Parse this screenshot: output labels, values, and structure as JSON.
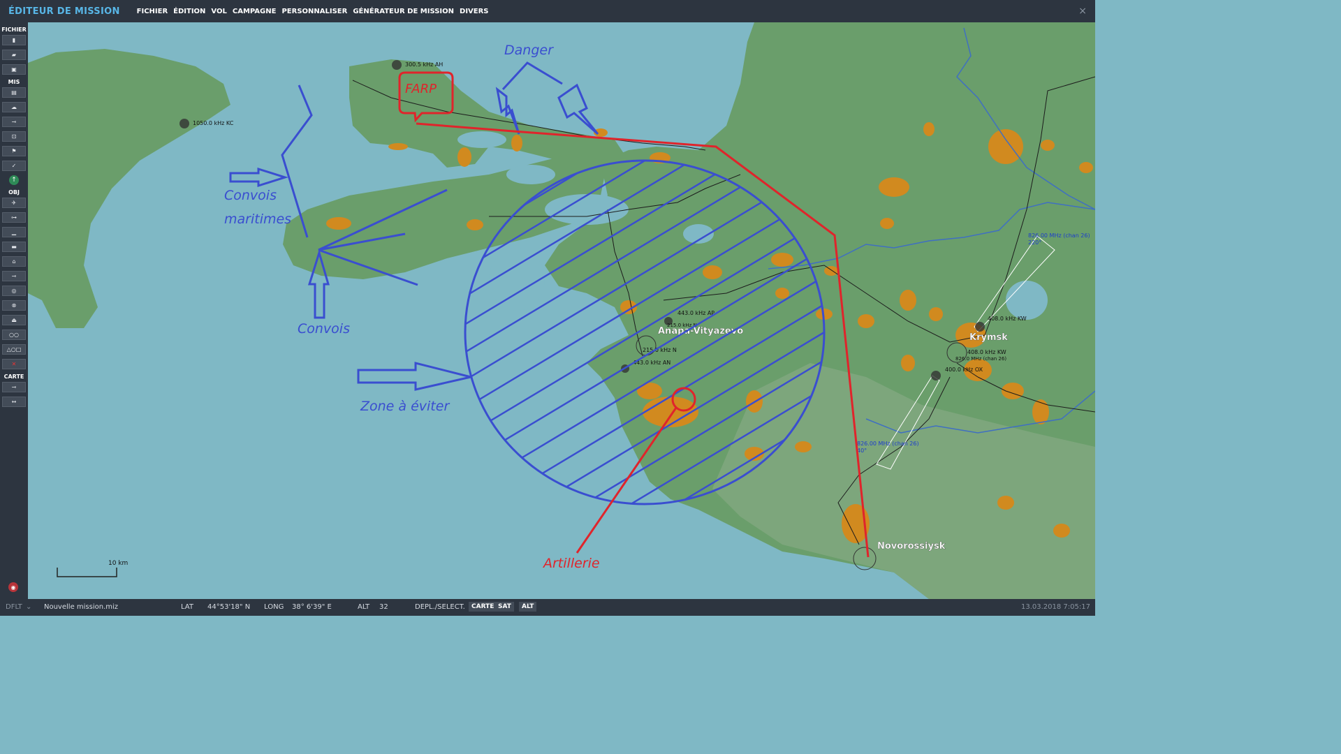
{
  "app": {
    "title": "ÉDITEUR DE MISSION",
    "close": "×"
  },
  "menu": [
    "FICHIER",
    "ÉDITION",
    "VOL",
    "CAMPAGNE",
    "PERSONNALISER",
    "GÉNÉRATEUR DE MISSION",
    "DIVERS"
  ],
  "sidebar": {
    "fichier": "FICHIER",
    "mis": "MIS",
    "obj": "OBJ",
    "carte": "CARTE",
    "buttons_fichier": [
      "new-file-icon",
      "open-file-icon",
      "save-file-icon"
    ],
    "buttons_mis": [
      "briefing-icon",
      "weather-icon",
      "triggers-icon",
      "camera-icon",
      "flag-icon",
      "check-icon"
    ],
    "buttons_obj": [
      "plane-icon",
      "helicopter-icon",
      "ship-icon",
      "vehicle-icon",
      "armor-icon",
      "static-object-icon",
      "target-icon",
      "zone-icon",
      "boat-icon",
      "chain-icon",
      "shapes-icon",
      "delete-icon"
    ],
    "buttons_carte": [
      "ruler-icon",
      "measure-icon"
    ]
  },
  "map": {
    "cities": [
      "Anapa-Vityazevo",
      "Krymsk",
      "Novorossiysk"
    ],
    "beacons": [
      {
        "label": "300.5 kHz AH"
      },
      {
        "label": "1050.0 kHz KC"
      },
      {
        "label": "443.0 kHz AP"
      },
      {
        "label": "215.0 kHz N"
      },
      {
        "label": "215.0 kHz N"
      },
      {
        "label": "443.0 kHz AN"
      },
      {
        "label": "408.0 kHz KW"
      },
      {
        "label": "408.0 kHz KW"
      },
      {
        "label": "400.0 kHz OX"
      },
      {
        "label": "826.0 MHz (chan 26)"
      }
    ],
    "ils": [
      {
        "freq": "826.00 MHz (chan 26)",
        "bearing": "220°"
      },
      {
        "freq": "826.00 MHz (chan 26)",
        "bearing": "40°"
      }
    ],
    "annotations": {
      "danger": "Danger",
      "farp": "FARP",
      "convois_maritimes_1": "Convois",
      "convois_maritimes_2": "maritimes",
      "convois": "Convois",
      "zone": "Zone à éviter",
      "artillerie": "Artillerie"
    },
    "scale": "10 km",
    "colors": {
      "sea": "#7fb8c5",
      "land": "#6a9e6b",
      "urban": "#d18a1f",
      "annotation_blue": "#3a4ed0",
      "annotation_red": "#e0242b"
    }
  },
  "status": {
    "profile": "DFLT",
    "file": "Nouvelle mission.miz",
    "lat_label": "LAT",
    "lat": "44°53'18\" N",
    "long_label": "LONG",
    "long": "38° 6'39\" E",
    "alt_label": "ALT",
    "alt": "32",
    "mode": "DEPL./SELECT.",
    "btn_carte": "CARTE",
    "btn_sat": "SAT",
    "btn_alt": "ALT",
    "datetime": "13.03.2018 7:05:17"
  }
}
